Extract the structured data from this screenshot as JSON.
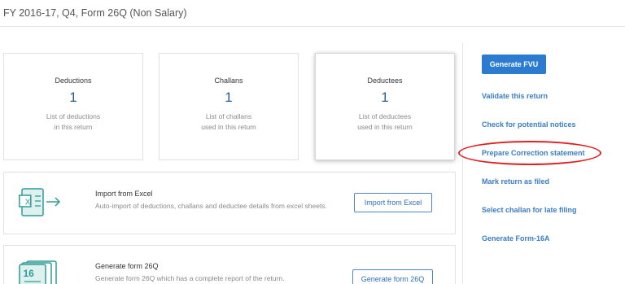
{
  "header": {
    "title": "FY 2016-17, Q4, Form 26Q (Non Salary)"
  },
  "cards": [
    {
      "title": "Deductions",
      "count": "1",
      "desc_line1": "List of deductions",
      "desc_line2": "in this return"
    },
    {
      "title": "Challans",
      "count": "1",
      "desc_line1": "List of challans",
      "desc_line2": "used in this return"
    },
    {
      "title": "Deductees",
      "count": "1",
      "desc_line1": "List of deductees",
      "desc_line2": "used in this return"
    }
  ],
  "import": {
    "title": "Import from Excel",
    "desc": "Auto-import of deductions, challans and deductee details from excel sheets.",
    "button": "Import from Excel",
    "icon_glyph": "X"
  },
  "generate": {
    "title": "Generate form 26Q",
    "desc": "Generate form 26Q which has a complete report of the return.",
    "button": "Generate form 26Q",
    "icon_number": "16"
  },
  "sidebar": {
    "primary_button": "Generate FVU",
    "links": [
      "Validate this return",
      "Check for potential notices",
      "Prepare Correction statement",
      "Mark return as filed",
      "Select challan for late filing",
      "Generate Form-16A"
    ]
  },
  "colors": {
    "accent": "#2b7bd1",
    "link": "#3a7ec7",
    "count": "#2a5d8f",
    "icon_teal": "#2f9c96",
    "highlight": "#e02020"
  }
}
